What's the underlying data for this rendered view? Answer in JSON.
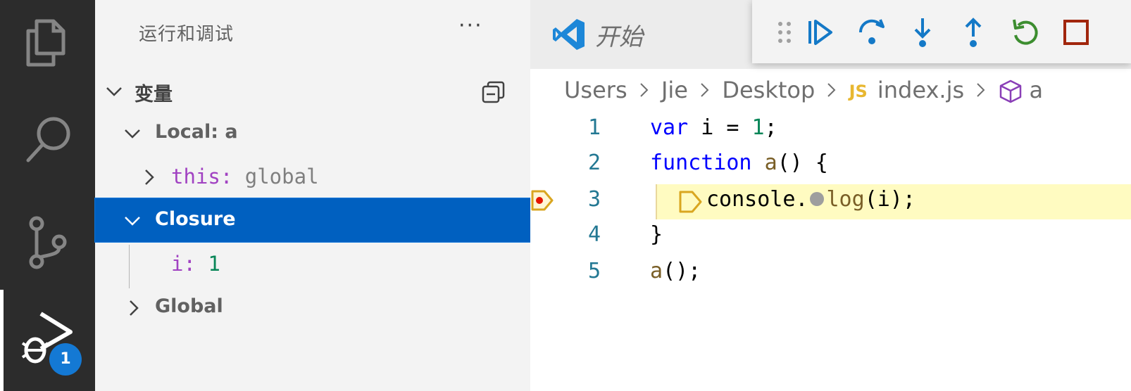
{
  "activity_bar": {
    "icons": [
      "files-icon",
      "search-icon",
      "source-control-icon",
      "run-debug-icon"
    ],
    "debug_badge": "1"
  },
  "sidebar": {
    "title": "运行和调试",
    "more_label": "···",
    "variables_section": {
      "label": "变量",
      "scopes": [
        {
          "label": "Local: a",
          "expanded": true,
          "items": [
            {
              "name": "this",
              "value": "global"
            }
          ]
        },
        {
          "label": "Closure",
          "expanded": true,
          "selected": true,
          "items": [
            {
              "name": "i",
              "value": "1"
            }
          ]
        },
        {
          "label": "Global",
          "expanded": false
        }
      ]
    }
  },
  "editor": {
    "tab_title": "开始",
    "debug_toolbar": [
      "continue",
      "step-over",
      "step-into",
      "step-out",
      "restart",
      "stop"
    ],
    "breadcrumb": {
      "items": [
        "Users",
        "Jie",
        "Desktop"
      ],
      "file_badge": "JS",
      "file": "index.js",
      "symbol": "a"
    },
    "gutter": [
      "1",
      "2",
      "3",
      "4",
      "5"
    ],
    "code": {
      "l1_kw": "var",
      "l1_rest": " i = ",
      "l1_num": "1",
      "l1_end": ";",
      "l2_kw": "function",
      "l2_sp": " ",
      "l2_fn": "a",
      "l2_end": "() {",
      "l3_a": "console.",
      "l3_fn": "log",
      "l3_b": "(i);",
      "l4": "}",
      "l5_fn": "a",
      "l5_end": "();"
    },
    "current_line": 3
  },
  "colors": {
    "accent": "#0060c0",
    "badge": "#1479d4",
    "debug_blue": "#1479c7",
    "restart_green": "#3c8d2f",
    "stop_red": "#a1260d"
  }
}
